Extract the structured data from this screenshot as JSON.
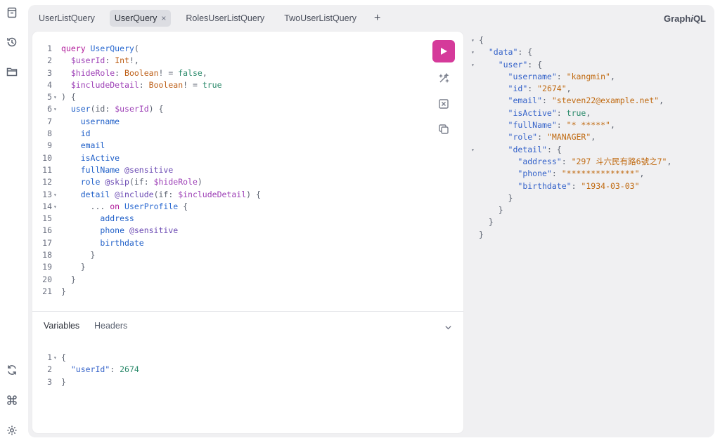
{
  "app": {
    "brand_prefix": "Graph",
    "brand_suffix": "i",
    "brand_end": "QL"
  },
  "tabs": [
    {
      "label": "UserListQuery",
      "active": false
    },
    {
      "label": "UserQuery",
      "active": true
    },
    {
      "label": "RolesUserListQuery",
      "active": false
    },
    {
      "label": "TwoUserListQuery",
      "active": false
    }
  ],
  "tab_add": "+",
  "tab_close": "×",
  "rail_icons": [
    "docs-icon",
    "history-icon",
    "explorer-icon",
    "refetch-schema-icon",
    "shortcuts-icon",
    "settings-icon"
  ],
  "toolbar_icons": [
    "run-icon",
    "prettify-icon",
    "merge-fragments-icon",
    "copy-icon"
  ],
  "accent_color": "#d53a9a",
  "query_lines": [
    {
      "n": "1",
      "fold": "",
      "indent": 0,
      "tokens": [
        [
          "kw",
          "query "
        ],
        [
          "def",
          "UserQuery"
        ],
        [
          "pn",
          "("
        ]
      ]
    },
    {
      "n": "2",
      "fold": "",
      "indent": 2,
      "tokens": [
        [
          "var",
          "$userId"
        ],
        [
          "pn",
          ": "
        ],
        [
          "typ",
          "Int"
        ],
        [
          "pn",
          "!,"
        ]
      ]
    },
    {
      "n": "3",
      "fold": "",
      "indent": 2,
      "tokens": [
        [
          "var",
          "$hideRole"
        ],
        [
          "pn",
          ": "
        ],
        [
          "typ",
          "Boolean"
        ],
        [
          "pn",
          "! = "
        ],
        [
          "boo",
          "false"
        ],
        [
          "pn",
          ","
        ]
      ]
    },
    {
      "n": "4",
      "fold": "",
      "indent": 2,
      "tokens": [
        [
          "var",
          "$includeDetail"
        ],
        [
          "pn",
          ": "
        ],
        [
          "typ",
          "Boolean"
        ],
        [
          "pn",
          "! = "
        ],
        [
          "boo",
          "true"
        ]
      ]
    },
    {
      "n": "5",
      "fold": "▾",
      "indent": 0,
      "tokens": [
        [
          "pn",
          ") {"
        ]
      ]
    },
    {
      "n": "6",
      "fold": "▾",
      "indent": 2,
      "tokens": [
        [
          "fld",
          "user"
        ],
        [
          "pn",
          "(id: "
        ],
        [
          "var",
          "$userId"
        ],
        [
          "pn",
          ") {"
        ]
      ]
    },
    {
      "n": "7",
      "fold": "",
      "indent": 4,
      "tokens": [
        [
          "fld",
          "username"
        ]
      ]
    },
    {
      "n": "8",
      "fold": "",
      "indent": 4,
      "tokens": [
        [
          "fld",
          "id"
        ]
      ]
    },
    {
      "n": "9",
      "fold": "",
      "indent": 4,
      "tokens": [
        [
          "fld",
          "email"
        ]
      ]
    },
    {
      "n": "10",
      "fold": "",
      "indent": 4,
      "tokens": [
        [
          "fld",
          "isActive"
        ]
      ]
    },
    {
      "n": "11",
      "fold": "",
      "indent": 4,
      "tokens": [
        [
          "fld",
          "fullName "
        ],
        [
          "dir",
          "@sensitive"
        ]
      ]
    },
    {
      "n": "12",
      "fold": "",
      "indent": 4,
      "tokens": [
        [
          "fld",
          "role "
        ],
        [
          "dir",
          "@skip"
        ],
        [
          "pn",
          "(if: "
        ],
        [
          "var",
          "$hideRole"
        ],
        [
          "pn",
          ")"
        ]
      ]
    },
    {
      "n": "13",
      "fold": "▾",
      "indent": 4,
      "tokens": [
        [
          "fld",
          "detail "
        ],
        [
          "dir",
          "@include"
        ],
        [
          "pn",
          "(if: "
        ],
        [
          "var",
          "$includeDetail"
        ],
        [
          "pn",
          ") {"
        ]
      ]
    },
    {
      "n": "14",
      "fold": "▾",
      "indent": 6,
      "tokens": [
        [
          "pn",
          "... "
        ],
        [
          "kw",
          "on "
        ],
        [
          "def",
          "UserProfile"
        ],
        [
          "pn",
          " {"
        ]
      ]
    },
    {
      "n": "15",
      "fold": "",
      "indent": 8,
      "tokens": [
        [
          "fld",
          "address"
        ]
      ]
    },
    {
      "n": "16",
      "fold": "",
      "indent": 8,
      "tokens": [
        [
          "fld",
          "phone "
        ],
        [
          "dir",
          "@sensitive"
        ]
      ]
    },
    {
      "n": "17",
      "fold": "",
      "indent": 8,
      "tokens": [
        [
          "fld",
          "birthdate"
        ]
      ]
    },
    {
      "n": "18",
      "fold": "",
      "indent": 6,
      "tokens": [
        [
          "pn",
          "}"
        ]
      ]
    },
    {
      "n": "19",
      "fold": "",
      "indent": 4,
      "tokens": [
        [
          "pn",
          "}"
        ]
      ]
    },
    {
      "n": "20",
      "fold": "",
      "indent": 2,
      "tokens": [
        [
          "pn",
          "}"
        ]
      ]
    },
    {
      "n": "21",
      "fold": "",
      "indent": 0,
      "tokens": [
        [
          "pn",
          "}"
        ]
      ]
    }
  ],
  "variables_panel": {
    "tab_variables": "Variables",
    "tab_headers": "Headers"
  },
  "variables_lines": [
    {
      "n": "1",
      "fold": "▾",
      "indent": 0,
      "tokens": [
        [
          "pn",
          "{"
        ]
      ]
    },
    {
      "n": "2",
      "fold": "",
      "indent": 2,
      "tokens": [
        [
          "key",
          "\"userId\""
        ],
        [
          "pn",
          ": "
        ],
        [
          "num",
          "2674"
        ]
      ]
    },
    {
      "n": "3",
      "fold": "",
      "indent": 0,
      "tokens": [
        [
          "pn",
          "}"
        ]
      ]
    }
  ],
  "result_lines": [
    {
      "fold": "▾",
      "indent": 0,
      "tokens": [
        [
          "pn",
          "{"
        ]
      ]
    },
    {
      "fold": "▾",
      "indent": 2,
      "tokens": [
        [
          "key",
          "\"data\""
        ],
        [
          "pn",
          ": {"
        ]
      ]
    },
    {
      "fold": "▾",
      "indent": 4,
      "tokens": [
        [
          "key",
          "\"user\""
        ],
        [
          "pn",
          ": {"
        ]
      ]
    },
    {
      "fold": "",
      "indent": 6,
      "tokens": [
        [
          "key",
          "\"username\""
        ],
        [
          "pn",
          ": "
        ],
        [
          "str",
          "\"kangmin\""
        ],
        [
          "pn",
          ","
        ]
      ]
    },
    {
      "fold": "",
      "indent": 6,
      "tokens": [
        [
          "key",
          "\"id\""
        ],
        [
          "pn",
          ": "
        ],
        [
          "str",
          "\"2674\""
        ],
        [
          "pn",
          ","
        ]
      ]
    },
    {
      "fold": "",
      "indent": 6,
      "tokens": [
        [
          "key",
          "\"email\""
        ],
        [
          "pn",
          ": "
        ],
        [
          "str",
          "\"steven22@example.net\""
        ],
        [
          "pn",
          ","
        ]
      ]
    },
    {
      "fold": "",
      "indent": 6,
      "tokens": [
        [
          "key",
          "\"isActive\""
        ],
        [
          "pn",
          ": "
        ],
        [
          "boo",
          "true"
        ],
        [
          "pn",
          ","
        ]
      ]
    },
    {
      "fold": "",
      "indent": 6,
      "tokens": [
        [
          "key",
          "\"fullName\""
        ],
        [
          "pn",
          ": "
        ],
        [
          "str",
          "\"* *****\""
        ],
        [
          "pn",
          ","
        ]
      ]
    },
    {
      "fold": "",
      "indent": 6,
      "tokens": [
        [
          "key",
          "\"role\""
        ],
        [
          "pn",
          ": "
        ],
        [
          "str",
          "\"MANAGER\""
        ],
        [
          "pn",
          ","
        ]
      ]
    },
    {
      "fold": "▾",
      "indent": 6,
      "tokens": [
        [
          "key",
          "\"detail\""
        ],
        [
          "pn",
          ": {"
        ]
      ]
    },
    {
      "fold": "",
      "indent": 8,
      "tokens": [
        [
          "key",
          "\"address\""
        ],
        [
          "pn",
          ": "
        ],
        [
          "str",
          "\"297 斗六民有路6號之7\""
        ],
        [
          "pn",
          ","
        ]
      ]
    },
    {
      "fold": "",
      "indent": 8,
      "tokens": [
        [
          "key",
          "\"phone\""
        ],
        [
          "pn",
          ": "
        ],
        [
          "str",
          "\"**************\""
        ],
        [
          "pn",
          ","
        ]
      ]
    },
    {
      "fold": "",
      "indent": 8,
      "tokens": [
        [
          "key",
          "\"birthdate\""
        ],
        [
          "pn",
          ": "
        ],
        [
          "str",
          "\"1934-03-03\""
        ]
      ]
    },
    {
      "fold": "",
      "indent": 6,
      "tokens": [
        [
          "pn",
          "}"
        ]
      ]
    },
    {
      "fold": "",
      "indent": 4,
      "tokens": [
        [
          "pn",
          "}"
        ]
      ]
    },
    {
      "fold": "",
      "indent": 2,
      "tokens": [
        [
          "pn",
          "}"
        ]
      ]
    },
    {
      "fold": "",
      "indent": 0,
      "tokens": [
        [
          "pn",
          "}"
        ]
      ]
    }
  ]
}
